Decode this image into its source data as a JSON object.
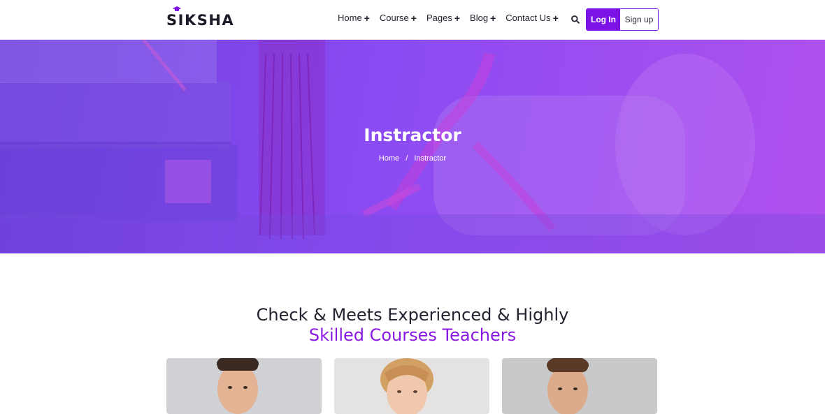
{
  "header": {
    "logo": "SIKSHA",
    "nav": [
      {
        "label": "Home",
        "icon": "plus-icon"
      },
      {
        "label": "Course",
        "icon": "plus-icon"
      },
      {
        "label": "Pages",
        "icon": "plus-icon"
      },
      {
        "label": "Blog",
        "icon": "plus-icon"
      },
      {
        "label": "Contact Us",
        "icon": "plus-icon"
      }
    ],
    "search_icon": "search-icon",
    "login_label": "Log In",
    "signup_label": "Sign up"
  },
  "hero": {
    "title": "Instractor",
    "breadcrumb": {
      "home": "Home",
      "separator": "/",
      "current": "Instractor"
    }
  },
  "section": {
    "title_line1": "Check & Meets Experienced & Highly",
    "title_line2": "Skilled Courses Teachers"
  },
  "colors": {
    "accent": "#7b12e6",
    "heading_accent": "#8a18e3",
    "hero_start": "#6b3ddb",
    "hero_end": "#b050ee"
  }
}
